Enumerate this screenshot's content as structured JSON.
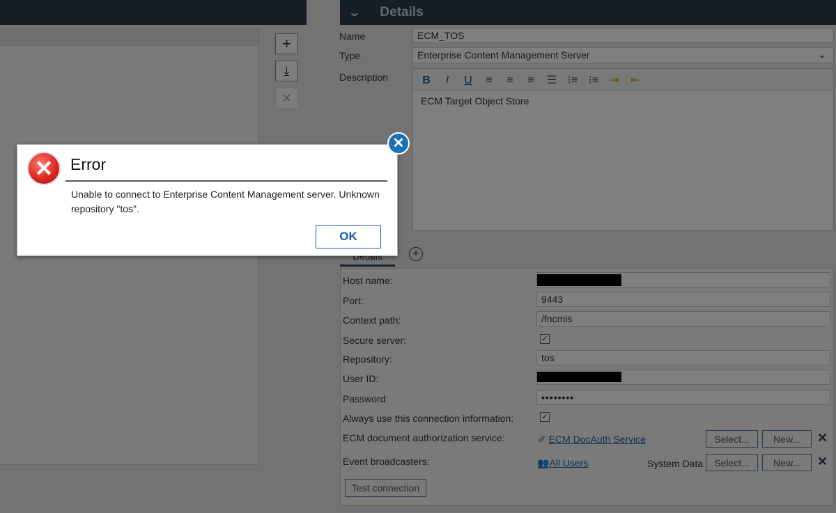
{
  "left_panel": {
    "toolbar": {
      "add_icon": "plus-icon",
      "import_icon": "download-icon",
      "delete_icon": "close-icon"
    }
  },
  "details": {
    "header": "Details",
    "name_label": "Name",
    "name_value": "ECM_TOS",
    "type_label": "Type",
    "type_value": "Enterprise Content Management Server",
    "description_label": "Description",
    "description_value": "ECM Target Object Store",
    "editor_tools": [
      "B",
      "I",
      "U"
    ],
    "tab_label": "Details",
    "rows": {
      "host_label": "Host name:",
      "port_label": "Port:",
      "port_value": "9443",
      "context_label": "Context path:",
      "context_value": "/fncmis",
      "secure_label": "Secure server:",
      "secure_checked": true,
      "repo_label": "Repository:",
      "repo_value": "tos",
      "user_label": "User ID:",
      "password_label": "Password:",
      "password_value": "••••••••",
      "always_label": "Always use this connection information:",
      "always_checked": true,
      "docauth_label": "ECM document authorization service:",
      "docauth_link": "ECM DocAuth Service",
      "event_label": "Event broadcasters:",
      "event_link": "All Users",
      "event_extra": "System Data",
      "select_label": "Select...",
      "new_label": "New...",
      "remove_glyph": "✕"
    },
    "test_connection": "Test connection"
  },
  "dialog": {
    "title": "Error",
    "message": "Unable to connect to Enterprise Content Management server. Unknown repository \"tos\".",
    "ok": "OK",
    "icon": "error-icon"
  },
  "colors": {
    "header": "#2d3e50",
    "accent": "#1a73b8",
    "error": "#d9241f"
  }
}
